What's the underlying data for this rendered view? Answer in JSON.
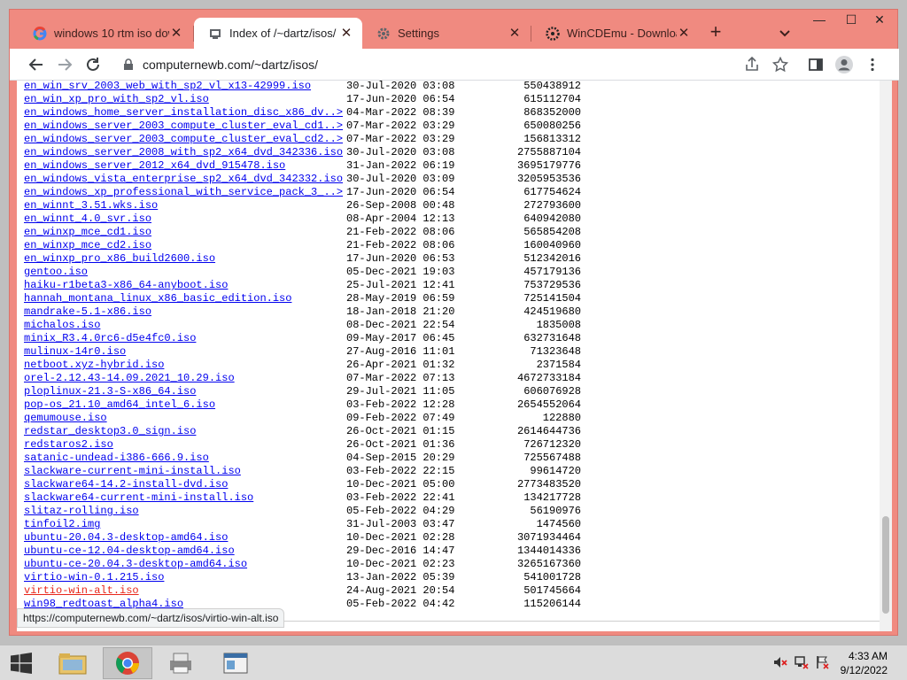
{
  "browser": {
    "tabs": [
      {
        "title": "windows 10 rtm iso dow",
        "icon": "google-icon",
        "active": false
      },
      {
        "title": "Index of /~dartz/isos/",
        "icon": "site-icon",
        "active": true
      },
      {
        "title": "Settings",
        "icon": "gear-icon",
        "active": false
      },
      {
        "title": "WinCDEmu - Download",
        "icon": "wincdemu-icon",
        "active": false
      }
    ],
    "new_tab": "+",
    "window_controls": {
      "minimize": "—",
      "maximize": "☐",
      "close": "✕"
    },
    "url": "computernewb.com/~dartz/isos/",
    "status_url": "https://computernewb.com/~dartz/isos/virtio-win-alt.iso",
    "frame_color": "#f08a80"
  },
  "listing": [
    {
      "name": "en_win_srv_2003_web_with_sp2_vl_x13-42999.iso",
      "date": "30-Jul-2020 03:08",
      "size": "550438912"
    },
    {
      "name": "en_win_xp_pro_with_sp2_vl.iso",
      "date": "17-Jun-2020 06:54",
      "size": "615112704"
    },
    {
      "name": "en_windows_home_server_installation_disc_x86_dv..>",
      "date": "04-Mar-2022 08:39",
      "size": "868352000"
    },
    {
      "name": "en_windows_server_2003_compute_cluster_eval_cd1..>",
      "date": "07-Mar-2022 03:29",
      "size": "650080256"
    },
    {
      "name": "en_windows_server_2003_compute_cluster_eval_cd2..>",
      "date": "07-Mar-2022 03:29",
      "size": "156813312"
    },
    {
      "name": "en_windows_server_2008_with_sp2_x64_dvd_342336.iso",
      "date": "30-Jul-2020 03:08",
      "size": "2755887104"
    },
    {
      "name": "en_windows_server_2012_x64_dvd_915478.iso",
      "date": "31-Jan-2022 06:19",
      "size": "3695179776"
    },
    {
      "name": "en_windows_vista_enterprise_sp2_x64_dvd_342332.iso",
      "date": "30-Jul-2020 03:09",
      "size": "3205953536"
    },
    {
      "name": "en_windows_xp_professional_with_service_pack_3_..>",
      "date": "17-Jun-2020 06:54",
      "size": "617754624"
    },
    {
      "name": "en_winnt_3.51.wks.iso",
      "date": "26-Sep-2008 00:48",
      "size": "272793600"
    },
    {
      "name": "en_winnt_4.0_svr.iso",
      "date": "08-Apr-2004 12:13",
      "size": "640942080"
    },
    {
      "name": "en_winxp_mce_cd1.iso",
      "date": "21-Feb-2022 08:06",
      "size": "565854208"
    },
    {
      "name": "en_winxp_mce_cd2.iso",
      "date": "21-Feb-2022 08:06",
      "size": "160040960"
    },
    {
      "name": "en_winxp_pro_x86_build2600.iso",
      "date": "17-Jun-2020 06:53",
      "size": "512342016"
    },
    {
      "name": "gentoo.iso",
      "date": "05-Dec-2021 19:03",
      "size": "457179136"
    },
    {
      "name": "haiku-r1beta3-x86_64-anyboot.iso",
      "date": "25-Jul-2021 12:41",
      "size": "753729536"
    },
    {
      "name": "hannah_montana_linux_x86_basic_edition.iso",
      "date": "28-May-2019 06:59",
      "size": "725141504"
    },
    {
      "name": "mandrake-5.1-x86.iso",
      "date": "18-Jan-2018 21:20",
      "size": "424519680"
    },
    {
      "name": "michalos.iso",
      "date": "08-Dec-2021 22:54",
      "size": "1835008"
    },
    {
      "name": "minix_R3.4.0rc6-d5e4fc0.iso",
      "date": "09-May-2017 06:45",
      "size": "632731648"
    },
    {
      "name": "mulinux-14r0.iso",
      "date": "27-Aug-2016 11:01",
      "size": "71323648"
    },
    {
      "name": "netboot.xyz-hybrid.iso",
      "date": "26-Apr-2021 01:32",
      "size": "2371584"
    },
    {
      "name": "orel-2.12.43-14.09.2021_10.29.iso",
      "date": "07-Mar-2022 07:13",
      "size": "4672733184"
    },
    {
      "name": "ploplinux-21.3-S-x86_64.iso",
      "date": "29-Jul-2021 11:05",
      "size": "606076928"
    },
    {
      "name": "pop-os_21.10_amd64_intel_6.iso",
      "date": "03-Feb-2022 12:28",
      "size": "2654552064"
    },
    {
      "name": "qemumouse.iso",
      "date": "09-Feb-2022 07:49",
      "size": "122880"
    },
    {
      "name": "redstar_desktop3.0_sign.iso",
      "date": "26-Oct-2021 01:15",
      "size": "2614644736"
    },
    {
      "name": "redstaros2.iso",
      "date": "26-Oct-2021 01:36",
      "size": "726712320"
    },
    {
      "name": "satanic-undead-i386-666.9.iso",
      "date": "04-Sep-2015 20:29",
      "size": "725567488"
    },
    {
      "name": "slackware-current-mini-install.iso",
      "date": "03-Feb-2022 22:15",
      "size": "99614720"
    },
    {
      "name": "slackware64-14.2-install-dvd.iso",
      "date": "10-Dec-2021 05:00",
      "size": "2773483520"
    },
    {
      "name": "slackware64-current-mini-install.iso",
      "date": "03-Feb-2022 22:41",
      "size": "134217728"
    },
    {
      "name": "slitaz-rolling.iso",
      "date": "05-Feb-2022 04:29",
      "size": "56190976"
    },
    {
      "name": "tinfoil2.img",
      "date": "31-Jul-2003 03:47",
      "size": "1474560"
    },
    {
      "name": "ubuntu-20.04.3-desktop-amd64.iso",
      "date": "10-Dec-2021 02:28",
      "size": "3071934464"
    },
    {
      "name": "ubuntu-ce-12.04-desktop-amd64.iso",
      "date": "29-Dec-2016 14:47",
      "size": "1344014336"
    },
    {
      "name": "ubuntu-ce-20.04.3-desktop-amd64.iso",
      "date": "10-Dec-2021 02:23",
      "size": "3265167360"
    },
    {
      "name": "virtio-win-0.1.215.iso",
      "date": "13-Jan-2022 05:39",
      "size": "541001728"
    },
    {
      "name": "virtio-win-alt.iso",
      "date": "24-Aug-2021 20:54",
      "size": "501745664",
      "hovered": true
    },
    {
      "name": "win98_redtoast_alpha4.iso",
      "date": "05-Feb-2022 04:42",
      "size": "115206144"
    }
  ],
  "taskbar": {
    "items": [
      "start-icon",
      "file-explorer-icon",
      "chrome-icon",
      "printer-icon",
      "app-window-icon"
    ],
    "tray": [
      "volume-muted-icon",
      "network-icon",
      "flag-icon"
    ],
    "time": "4:33 AM",
    "date": "9/12/2022"
  }
}
